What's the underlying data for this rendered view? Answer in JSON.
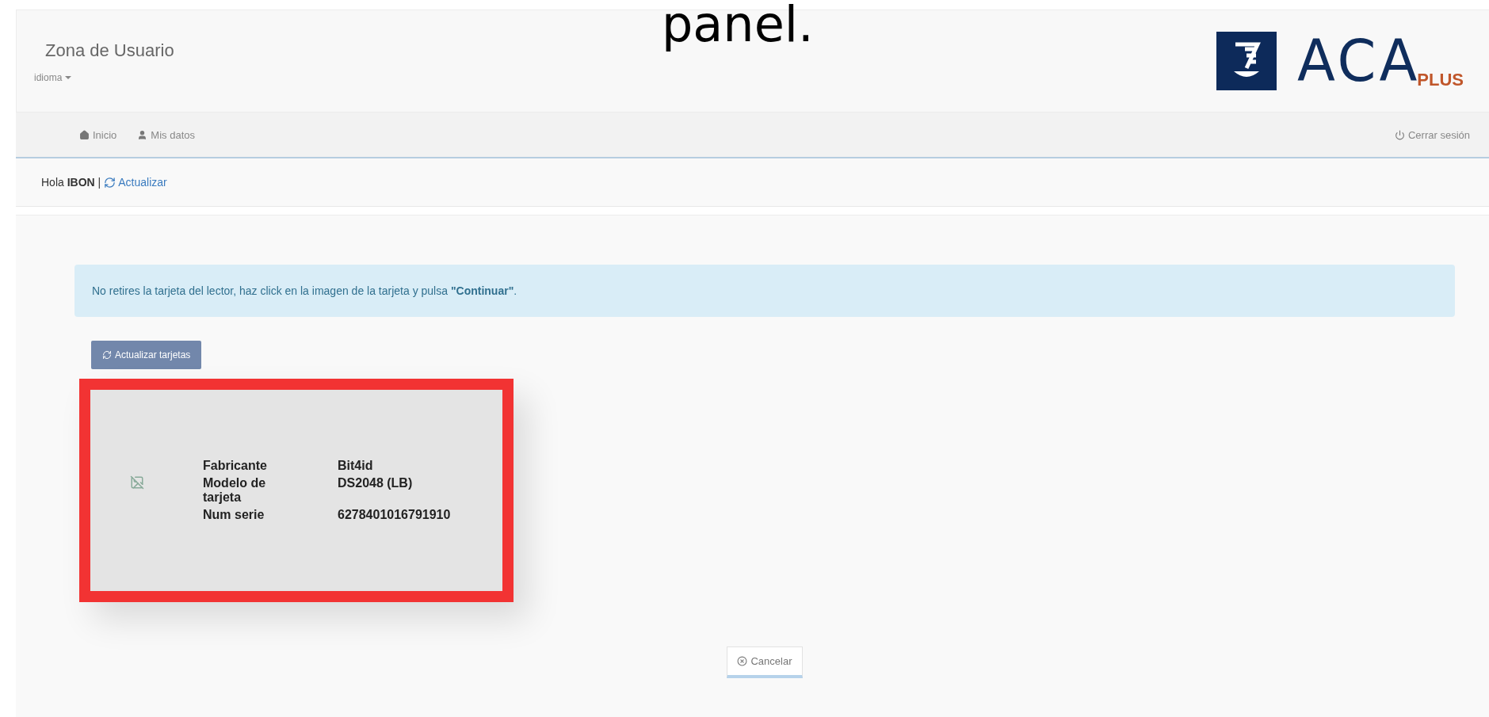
{
  "caption": "panel.",
  "header": {
    "title": "Zona de Usuario",
    "language_menu": "idioma"
  },
  "logo": {
    "letters": "ACA",
    "suffix": "PLUS"
  },
  "nav": {
    "items": [
      {
        "label": "Inicio",
        "kind": "home"
      },
      {
        "label": "Mis datos",
        "kind": "user"
      }
    ],
    "logout": "Cerrar sesión"
  },
  "greeting": {
    "text": "Hola **IBON** |",
    "link": "Actualizar"
  },
  "alert": "No retires la tarjeta del lector, haz click en la imagen de la tarjeta y pulsa **\"Continuar\"**.",
  "refresh_button": "Actualizar tarjetas",
  "card": {
    "highlighted": true,
    "rows": [
      {
        "label": "Fabricante",
        "value": "Bit4id"
      },
      {
        "label": "Modelo de tarjeta",
        "value": "DS2048 (LB)"
      },
      {
        "label": "Num serie",
        "value": "6278401016791910"
      }
    ]
  },
  "cancel_button": "Cancelar"
}
